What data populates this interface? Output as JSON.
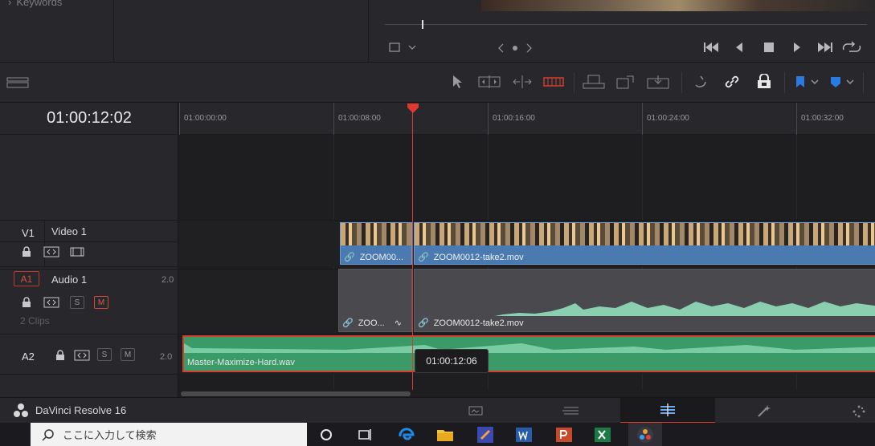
{
  "media_pool": {
    "keywords_label": "Keywords"
  },
  "timeline": {
    "timecode": "01:00:12:02",
    "ruler_labels": [
      "01:00:00:00",
      "01:00:08:00",
      "01:00:16:00",
      "01:00:24:00",
      "01:00:32:00"
    ],
    "playhead_tooltip": "01:00:12:06"
  },
  "tracks": {
    "v1": {
      "id": "V1",
      "name": "Video 1"
    },
    "a1": {
      "id": "A1",
      "name": "Audio 1",
      "channels": "2.0",
      "clip_count": "2 Clips",
      "solo": "S",
      "mute": "M"
    },
    "a2": {
      "id": "A2",
      "channels": "2.0",
      "solo": "S",
      "mute": "M"
    }
  },
  "clips": {
    "video_1": "ZOOM00...",
    "video_2": "ZOOM0012-take2.mov",
    "audio_1": "ZOO...",
    "audio_2": "ZOOM0012-take2.mov",
    "a2_clip": "Master-Maximize-Hard.wav"
  },
  "app": {
    "name": "DaVinci Resolve 16"
  },
  "taskbar": {
    "search_placeholder": "ここに入力して検索"
  },
  "colors": {
    "playhead": "#e03a30",
    "video_clip": "#4a7ab0",
    "audio_clip_a2": "#3a9a68",
    "flag": "#2a7ae0"
  }
}
